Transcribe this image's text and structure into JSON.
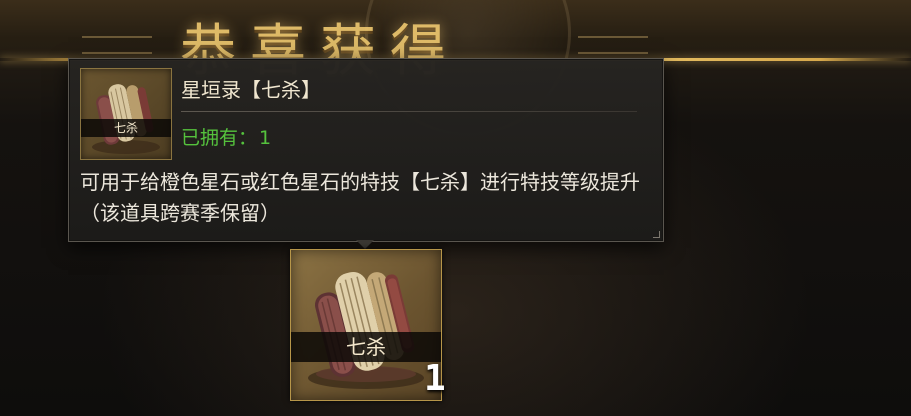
{
  "banner": {
    "title": "恭喜获得"
  },
  "tooltip": {
    "item_name": "星垣录【七杀】",
    "owned_label": "已拥有：",
    "owned_count": "1",
    "description": "可用于给橙色星石或红色星石的特技【七杀】进行特技等级提升（该道具跨赛季保留）",
    "thumb_label": "七杀"
  },
  "reward": {
    "item_label": "七杀",
    "count": "1"
  },
  "colors": {
    "gold_accent": "#f2cb71",
    "owned_green": "#55c23d",
    "panel_bg": "#262421"
  },
  "icons": {
    "item_icon": "scroll-bundle-icon"
  }
}
